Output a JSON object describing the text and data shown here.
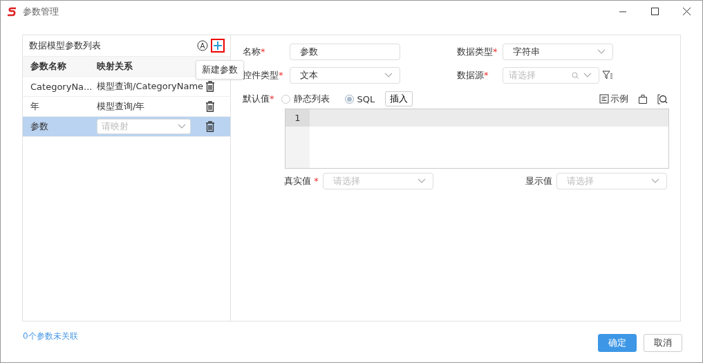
{
  "window": {
    "title": "参数管理"
  },
  "params_panel": {
    "title": "数据模型参数列表",
    "tooltip": "新建参数",
    "columns": [
      "参数名称",
      "映射关系"
    ],
    "rows": [
      {
        "name": "CategoryNa...",
        "kind": "text",
        "mapping": "模型查询/CategoryName",
        "selected": false
      },
      {
        "name": "年",
        "kind": "text",
        "mapping": "模型查询/年",
        "selected": false
      },
      {
        "name": "参数",
        "kind": "select",
        "placeholder": "请映射",
        "selected": true
      }
    ]
  },
  "form": {
    "name": {
      "label": "名称",
      "asterisk": "*",
      "value": "参数"
    },
    "data_type": {
      "label": "数据类型",
      "asterisk": "*",
      "value": "字符串"
    },
    "control_type": {
      "label": "控件类型",
      "asterisk": "*",
      "value": "文本"
    },
    "data_source": {
      "label": "数据源",
      "asterisk": "*",
      "placeholder": "请选择"
    },
    "default_value": {
      "label": "默认值",
      "asterisk": "*",
      "options": [
        {
          "label": "静态列表",
          "selected": false
        },
        {
          "label": "SQL",
          "selected": true
        }
      ],
      "insert_button": "插入",
      "example_button": "示例"
    },
    "editor": {
      "line_numbers": [
        "1"
      ]
    },
    "real_value": {
      "label": "真实值",
      "asterisk": "*",
      "placeholder": "请选择"
    },
    "display_value": {
      "label": "显示值",
      "placeholder": "请选择"
    }
  },
  "footer": {
    "link": "0个参数未关联",
    "buttons": [
      {
        "label": "确定",
        "kind": "primary"
      },
      {
        "label": "取消",
        "kind": "default"
      }
    ]
  }
}
